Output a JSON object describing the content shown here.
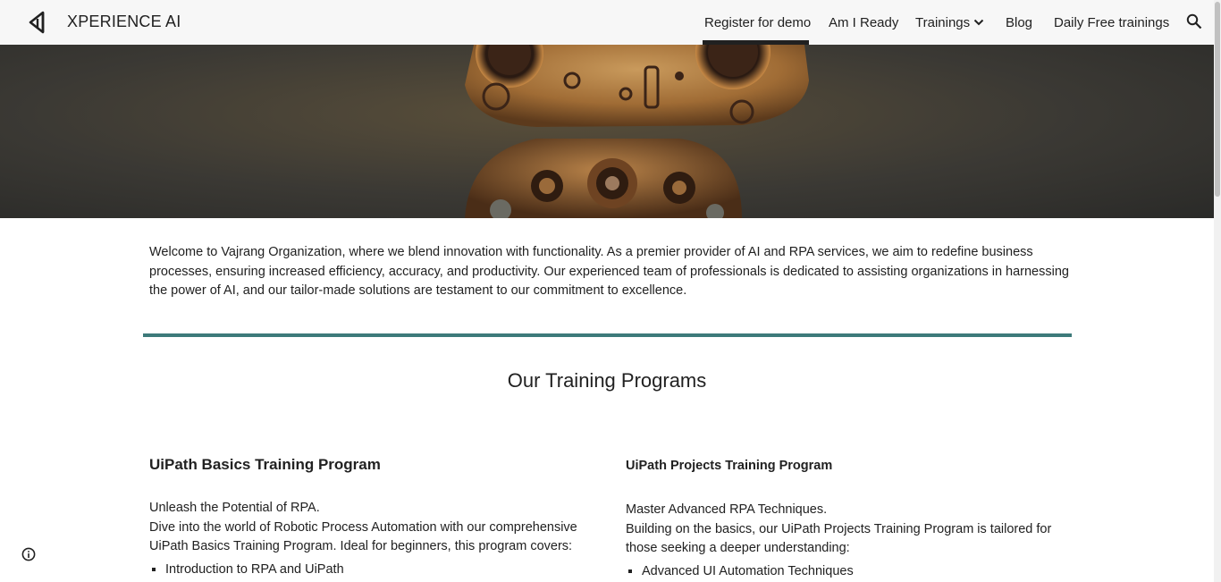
{
  "header": {
    "site_title": "XPERIENCE AI",
    "nav": [
      {
        "label": "Register for demo",
        "active": true
      },
      {
        "label": "Am I Ready"
      },
      {
        "label": "Trainings",
        "has_dropdown": true
      },
      {
        "label": "Blog"
      },
      {
        "label": "Daily Free trainings"
      }
    ],
    "icons": {
      "logo": "back-triangle-logo-icon",
      "search": "search-icon",
      "dropdown": "chevron-down-icon"
    }
  },
  "hero": {
    "image_name": "robot-hero-image"
  },
  "intro": {
    "text": "Welcome to Vajrang Organization, where we blend innovation with functionality. As a premier provider of AI and RPA services, we aim to redefine business processes, ensuring increased efficiency, accuracy, and productivity. Our experienced team of professionals is dedicated to assisting organizations in harnessing the power of AI, and our tailor-made solutions are testament to our commitment to excellence."
  },
  "programs": {
    "section_title": "Our Training Programs",
    "items": [
      {
        "title": "UiPath Basics Training Program",
        "tagline": "Unleash the Potential of RPA.",
        "description": "Dive into the world of Robotic Process Automation with our comprehensive UiPath Basics Training Program. Ideal for beginners, this program covers:",
        "bullets": [
          "Introduction to RPA and UiPath"
        ]
      },
      {
        "title": "UiPath Projects Training Program",
        "tagline": "Master Advanced RPA Techniques.",
        "description": "Building on the basics, our UiPath Projects Training Program is tailored for those seeking a deeper understanding:",
        "bullets": [
          "Advanced UI Automation Techniques"
        ]
      }
    ]
  },
  "colors": {
    "divider": "#3d7a7a",
    "topbar": "#f7f7f7"
  }
}
